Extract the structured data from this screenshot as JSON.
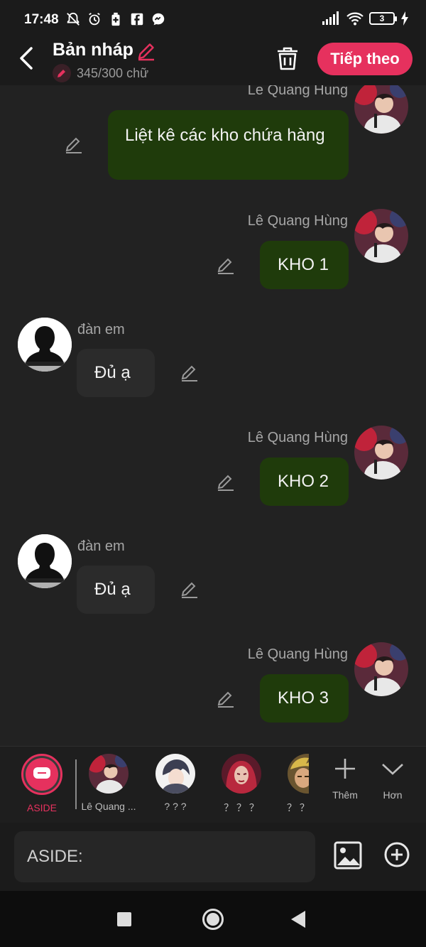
{
  "status_bar": {
    "time": "17:48",
    "battery": "3",
    "icons": [
      "mute-bell-icon",
      "alarm-icon",
      "battery-saver-icon",
      "facebook-icon",
      "messenger-icon",
      "signal-icon",
      "wifi-icon",
      "charging-icon"
    ]
  },
  "header": {
    "title": "Bản nháp",
    "count": "345/300 chữ",
    "next_label": "Tiếp theo",
    "accent": "#e6315e"
  },
  "messages": [
    {
      "side": "right",
      "name": "Le Quang Hung",
      "text": "Liệt kê các kho chứa hàng"
    },
    {
      "side": "right",
      "name": "Lê Quang Hùng",
      "text": "KHO 1"
    },
    {
      "side": "left",
      "name": "đàn em",
      "text": "Đủ ạ"
    },
    {
      "side": "right",
      "name": "Lê Quang Hùng",
      "text": "KHO 2"
    },
    {
      "side": "left",
      "name": "đàn em",
      "text": "Đủ ạ"
    },
    {
      "side": "right",
      "name": "Lê Quang Hùng",
      "text": "KHO 3"
    }
  ],
  "characters": {
    "aside_label": "ASIDE",
    "items": [
      {
        "label": "Lê Quang ..."
      },
      {
        "label": "? ? ?"
      },
      {
        "label": "？ ？ ？"
      },
      {
        "label": "？ ？"
      }
    ],
    "more_label": "Thêm",
    "expand_label": "Hơn"
  },
  "input": {
    "placeholder": "ASIDE:"
  },
  "colors": {
    "right_bubble": "#1f3b0b",
    "left_bubble": "#2b2b2b",
    "background": "#222222"
  }
}
